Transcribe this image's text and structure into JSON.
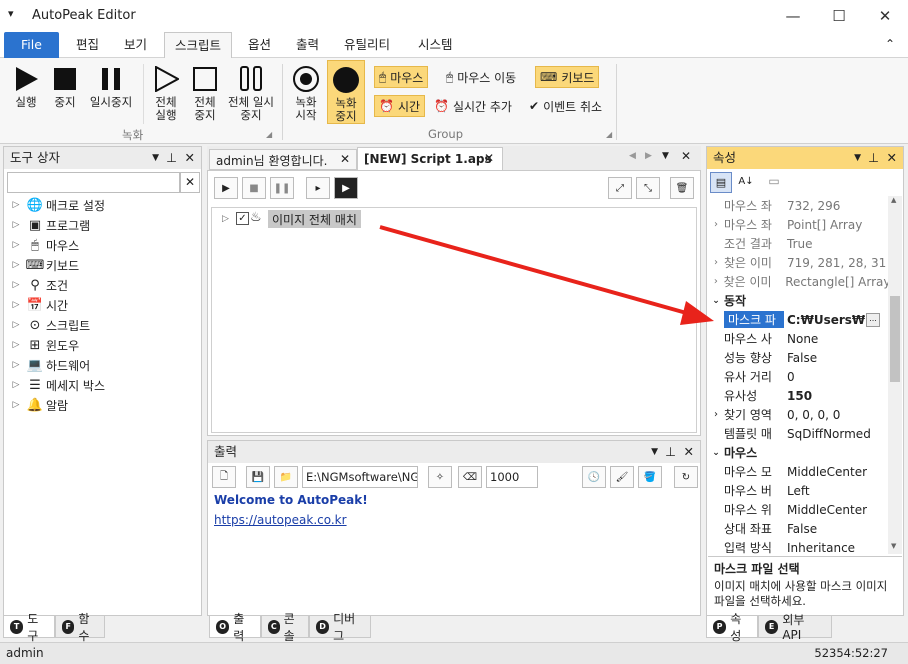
{
  "app": {
    "title": "AutoPeak Editor",
    "menu_arrow": "▾",
    "minimize": "—",
    "maximize": "☐",
    "close": "✕"
  },
  "menu": {
    "items": [
      "File",
      "편집",
      "보기",
      "스크립트",
      "옵션",
      "출력",
      "유틸리티",
      "시스템"
    ],
    "collapse": "⌃"
  },
  "ribbon": {
    "run": "실행",
    "stop": "중지",
    "pause": "일시중지",
    "run_all": "전체 실행",
    "stop_all": "전체 중지",
    "pause_all": "전체 일시중지",
    "group_record": "녹화",
    "rec_start": "녹화 시작",
    "rec_stop": "녹화 중지",
    "mouse": "마우스",
    "mouse_move": "마우스 이동",
    "keyboard": "키보드",
    "time": "시간",
    "realtime_add": "실시간 추가",
    "event_cancel": "이벤트 취소",
    "group_group": "Group"
  },
  "toolbox": {
    "title": "도구 상자",
    "search_placeholder": "",
    "clear": "✕",
    "items": [
      "매크로 설정",
      "프로그램",
      "마우스",
      "키보드",
      "조건",
      "시간",
      "스크립트",
      "윈도우",
      "하드웨어",
      "메세지 박스",
      "알람"
    ],
    "tabs": [
      "도구",
      "함수"
    ]
  },
  "editor": {
    "tabs": [
      "admin님 환영합니다.",
      "[NEW] Script 1.aps"
    ],
    "node_label": "이미지 전체 매치"
  },
  "output": {
    "title": "출력",
    "path": "E:\\NGMsoftware\\NG",
    "count": "1000",
    "welcome": "Welcome to AutoPeak!",
    "link": "https://autopeak.co.kr",
    "tabs": [
      "출력",
      "콘솔",
      "디버그"
    ]
  },
  "props": {
    "title": "속성",
    "rows": [
      {
        "name": "마우스 좌",
        "value": "732, 296",
        "exp": ""
      },
      {
        "name": "마우스 좌",
        "value": "Point[] Array",
        "exp": "›"
      },
      {
        "name": "조건 결과",
        "value": "True",
        "exp": ""
      },
      {
        "name": "찾은 이미",
        "value": "719, 281, 28, 31",
        "exp": "›"
      },
      {
        "name": "찾은 이미",
        "value": "Rectangle[] Array",
        "exp": "›"
      }
    ],
    "cat_action": "동작",
    "selected": {
      "name": "마스크 파",
      "value": "C:₩Users₩ngr",
      "btn": "..."
    },
    "rows2": [
      {
        "name": "마우스 사",
        "value": "None",
        "exp": "",
        "bold": false
      },
      {
        "name": "성능 향상",
        "value": "False",
        "exp": "",
        "bold": false
      },
      {
        "name": "유사 거리",
        "value": "0",
        "exp": "",
        "bold": false
      },
      {
        "name": "유사성",
        "value": "150",
        "exp": "",
        "bold": true
      },
      {
        "name": "찾기 영역",
        "value": "0, 0, 0, 0",
        "exp": "›",
        "bold": false
      },
      {
        "name": "템플릿 매",
        "value": "SqDiffNormed",
        "exp": "",
        "bold": false
      }
    ],
    "cat_mouse": "마우스",
    "rows3": [
      {
        "name": "마우스 모",
        "value": "MiddleCenter",
        "exp": ""
      },
      {
        "name": "마우스 버",
        "value": "Left",
        "exp": ""
      },
      {
        "name": "마우스 위",
        "value": "MiddleCenter",
        "exp": ""
      },
      {
        "name": "상대 좌표",
        "value": "False",
        "exp": ""
      },
      {
        "name": "입력 방식",
        "value": "Inheritance",
        "exp": ""
      }
    ],
    "desc_title": "마스크 파일 선택",
    "desc_text": "이미지 매치에 사용할 마스크 이미지 파일을 선택하세요.",
    "tabs": [
      "속성",
      "외부 API"
    ]
  },
  "status": {
    "user": "admin",
    "time": "52354:52:27"
  },
  "colors": {
    "accent": "#2b73cf",
    "highlight": "#fbd87a",
    "arrow": "#e8231b"
  }
}
